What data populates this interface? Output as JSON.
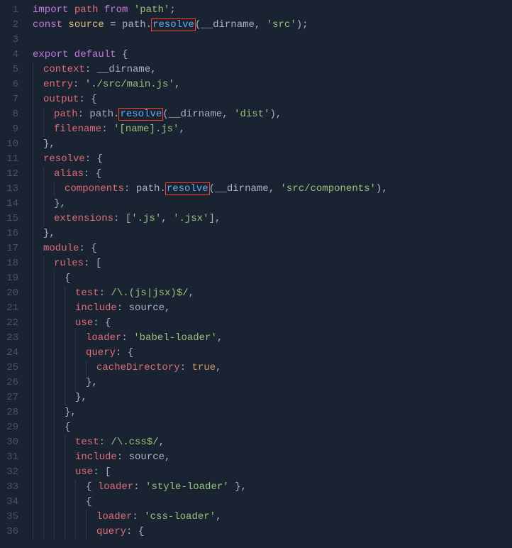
{
  "lines": [
    {
      "n": 1,
      "indent": 0,
      "tokens": [
        {
          "t": "import ",
          "c": "kw"
        },
        {
          "t": "path ",
          "c": "ident"
        },
        {
          "t": "from ",
          "c": "kw"
        },
        {
          "t": "'path'",
          "c": "str"
        },
        {
          "t": ";",
          "c": "punct"
        }
      ]
    },
    {
      "n": 2,
      "indent": 0,
      "tokens": [
        {
          "t": "const ",
          "c": "kw"
        },
        {
          "t": "source ",
          "c": "builtin"
        },
        {
          "t": "= ",
          "c": "punct"
        },
        {
          "t": "path",
          "c": "var"
        },
        {
          "t": ".",
          "c": "punct"
        },
        {
          "t": "resolve",
          "c": "fn",
          "hl": true
        },
        {
          "t": "(",
          "c": "punct"
        },
        {
          "t": "__dirname",
          "c": "var"
        },
        {
          "t": ", ",
          "c": "punct"
        },
        {
          "t": "'src'",
          "c": "str"
        },
        {
          "t": ");",
          "c": "punct"
        }
      ]
    },
    {
      "n": 3,
      "indent": 0,
      "tokens": []
    },
    {
      "n": 4,
      "indent": 0,
      "tokens": [
        {
          "t": "export default ",
          "c": "kw"
        },
        {
          "t": "{",
          "c": "punct"
        }
      ]
    },
    {
      "n": 5,
      "indent": 1,
      "tokens": [
        {
          "t": "context",
          "c": "prop"
        },
        {
          "t": ": ",
          "c": "punct"
        },
        {
          "t": "__dirname",
          "c": "var"
        },
        {
          "t": ",",
          "c": "punct"
        }
      ]
    },
    {
      "n": 6,
      "indent": 1,
      "tokens": [
        {
          "t": "entry",
          "c": "prop"
        },
        {
          "t": ": ",
          "c": "punct"
        },
        {
          "t": "'./src/main.js'",
          "c": "str"
        },
        {
          "t": ",",
          "c": "punct"
        }
      ]
    },
    {
      "n": 7,
      "indent": 1,
      "tokens": [
        {
          "t": "output",
          "c": "prop"
        },
        {
          "t": ": {",
          "c": "punct"
        }
      ]
    },
    {
      "n": 8,
      "indent": 2,
      "tokens": [
        {
          "t": "path",
          "c": "prop"
        },
        {
          "t": ": ",
          "c": "punct"
        },
        {
          "t": "path",
          "c": "var"
        },
        {
          "t": ".",
          "c": "punct"
        },
        {
          "t": "resolve",
          "c": "fn",
          "hl": true
        },
        {
          "t": "(",
          "c": "punct"
        },
        {
          "t": "__dirname",
          "c": "var"
        },
        {
          "t": ", ",
          "c": "punct"
        },
        {
          "t": "'dist'",
          "c": "str"
        },
        {
          "t": "),",
          "c": "punct"
        }
      ]
    },
    {
      "n": 9,
      "indent": 2,
      "tokens": [
        {
          "t": "filename",
          "c": "prop"
        },
        {
          "t": ": ",
          "c": "punct"
        },
        {
          "t": "'[name].js'",
          "c": "str"
        },
        {
          "t": ",",
          "c": "punct"
        }
      ]
    },
    {
      "n": 10,
      "indent": 1,
      "tokens": [
        {
          "t": "},",
          "c": "punct"
        }
      ]
    },
    {
      "n": 11,
      "indent": 1,
      "tokens": [
        {
          "t": "resolve",
          "c": "prop"
        },
        {
          "t": ": {",
          "c": "punct"
        }
      ]
    },
    {
      "n": 12,
      "indent": 2,
      "tokens": [
        {
          "t": "alias",
          "c": "prop"
        },
        {
          "t": ": {",
          "c": "punct"
        }
      ]
    },
    {
      "n": 13,
      "indent": 3,
      "tokens": [
        {
          "t": "components",
          "c": "prop"
        },
        {
          "t": ": ",
          "c": "punct"
        },
        {
          "t": "path",
          "c": "var"
        },
        {
          "t": ".",
          "c": "punct"
        },
        {
          "t": "resolve",
          "c": "fn",
          "hl": true
        },
        {
          "t": "(",
          "c": "punct"
        },
        {
          "t": "__dirname",
          "c": "var"
        },
        {
          "t": ", ",
          "c": "punct"
        },
        {
          "t": "'src/components'",
          "c": "str"
        },
        {
          "t": "),",
          "c": "punct"
        }
      ]
    },
    {
      "n": 14,
      "indent": 2,
      "tokens": [
        {
          "t": "},",
          "c": "punct"
        }
      ]
    },
    {
      "n": 15,
      "indent": 2,
      "tokens": [
        {
          "t": "extensions",
          "c": "prop"
        },
        {
          "t": ": [",
          "c": "punct"
        },
        {
          "t": "'.js'",
          "c": "str"
        },
        {
          "t": ", ",
          "c": "punct"
        },
        {
          "t": "'.jsx'",
          "c": "str"
        },
        {
          "t": "],",
          "c": "punct"
        }
      ]
    },
    {
      "n": 16,
      "indent": 1,
      "tokens": [
        {
          "t": "},",
          "c": "punct"
        }
      ]
    },
    {
      "n": 17,
      "indent": 1,
      "tokens": [
        {
          "t": "module",
          "c": "prop"
        },
        {
          "t": ": {",
          "c": "punct"
        }
      ]
    },
    {
      "n": 18,
      "indent": 2,
      "tokens": [
        {
          "t": "rules",
          "c": "prop"
        },
        {
          "t": ": [",
          "c": "punct"
        }
      ]
    },
    {
      "n": 19,
      "indent": 3,
      "tokens": [
        {
          "t": "{",
          "c": "punct"
        }
      ]
    },
    {
      "n": 20,
      "indent": 4,
      "tokens": [
        {
          "t": "test",
          "c": "prop"
        },
        {
          "t": ": ",
          "c": "punct"
        },
        {
          "t": "/\\.(js|jsx)$/",
          "c": "regex"
        },
        {
          "t": ",",
          "c": "punct"
        }
      ]
    },
    {
      "n": 21,
      "indent": 4,
      "tokens": [
        {
          "t": "include",
          "c": "prop"
        },
        {
          "t": ": ",
          "c": "punct"
        },
        {
          "t": "source",
          "c": "var"
        },
        {
          "t": ",",
          "c": "punct"
        }
      ]
    },
    {
      "n": 22,
      "indent": 4,
      "tokens": [
        {
          "t": "use",
          "c": "prop"
        },
        {
          "t": ": {",
          "c": "punct"
        }
      ]
    },
    {
      "n": 23,
      "indent": 5,
      "tokens": [
        {
          "t": "loader",
          "c": "prop"
        },
        {
          "t": ": ",
          "c": "punct"
        },
        {
          "t": "'babel-loader'",
          "c": "str"
        },
        {
          "t": ",",
          "c": "punct"
        }
      ]
    },
    {
      "n": 24,
      "indent": 5,
      "tokens": [
        {
          "t": "query",
          "c": "prop"
        },
        {
          "t": ": {",
          "c": "punct"
        }
      ]
    },
    {
      "n": 25,
      "indent": 6,
      "tokens": [
        {
          "t": "cacheDirectory",
          "c": "prop"
        },
        {
          "t": ": ",
          "c": "punct"
        },
        {
          "t": "true",
          "c": "bool"
        },
        {
          "t": ",",
          "c": "punct"
        }
      ]
    },
    {
      "n": 26,
      "indent": 5,
      "tokens": [
        {
          "t": "},",
          "c": "punct"
        }
      ]
    },
    {
      "n": 27,
      "indent": 4,
      "tokens": [
        {
          "t": "},",
          "c": "punct"
        }
      ]
    },
    {
      "n": 28,
      "indent": 3,
      "tokens": [
        {
          "t": "},",
          "c": "punct"
        }
      ]
    },
    {
      "n": 29,
      "indent": 3,
      "tokens": [
        {
          "t": "{",
          "c": "punct"
        }
      ]
    },
    {
      "n": 30,
      "indent": 4,
      "tokens": [
        {
          "t": "test",
          "c": "prop"
        },
        {
          "t": ": ",
          "c": "punct"
        },
        {
          "t": "/\\.css$/",
          "c": "regex"
        },
        {
          "t": ",",
          "c": "punct"
        }
      ]
    },
    {
      "n": 31,
      "indent": 4,
      "tokens": [
        {
          "t": "include",
          "c": "prop"
        },
        {
          "t": ": ",
          "c": "punct"
        },
        {
          "t": "source",
          "c": "var"
        },
        {
          "t": ",",
          "c": "punct"
        }
      ]
    },
    {
      "n": 32,
      "indent": 4,
      "tokens": [
        {
          "t": "use",
          "c": "prop"
        },
        {
          "t": ": [",
          "c": "punct"
        }
      ]
    },
    {
      "n": 33,
      "indent": 5,
      "tokens": [
        {
          "t": "{ ",
          "c": "punct"
        },
        {
          "t": "loader",
          "c": "prop"
        },
        {
          "t": ": ",
          "c": "punct"
        },
        {
          "t": "'style-loader'",
          "c": "str"
        },
        {
          "t": " },",
          "c": "punct"
        }
      ]
    },
    {
      "n": 34,
      "indent": 5,
      "tokens": [
        {
          "t": "{",
          "c": "punct"
        }
      ]
    },
    {
      "n": 35,
      "indent": 6,
      "tokens": [
        {
          "t": "loader",
          "c": "prop"
        },
        {
          "t": ": ",
          "c": "punct"
        },
        {
          "t": "'css-loader'",
          "c": "str"
        },
        {
          "t": ",",
          "c": "punct"
        }
      ]
    },
    {
      "n": 36,
      "indent": 6,
      "tokens": [
        {
          "t": "query",
          "c": "prop"
        },
        {
          "t": ": {",
          "c": "punct"
        }
      ]
    }
  ]
}
